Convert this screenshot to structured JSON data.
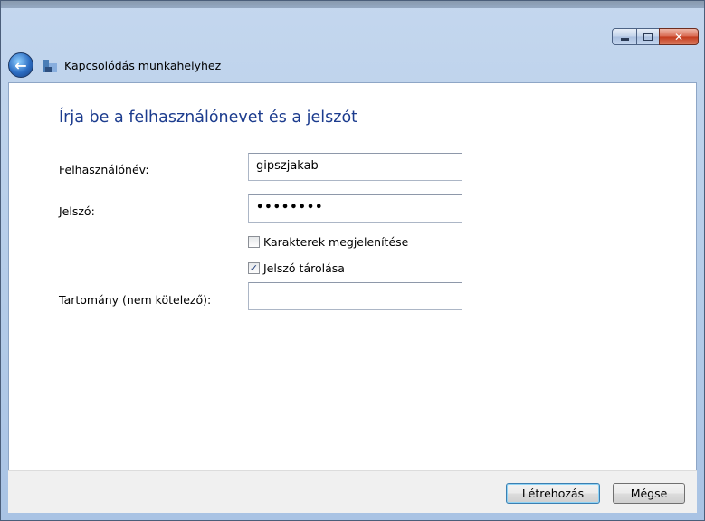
{
  "window": {
    "title": "Kapcsolódás munkahelyhez",
    "minimize_icon": "minimize-icon",
    "maximize_icon": "maximize-icon",
    "close_glyph": "✕"
  },
  "nav": {
    "back_glyph": "←",
    "app_icon": "network-workplace-icon"
  },
  "main": {
    "heading": "Írja be a felhasználónevet és a jelszót",
    "username": {
      "label": "Felhasználónév:",
      "value": "gipszjakab"
    },
    "password": {
      "label": "Jelszó:",
      "value": "••••••••"
    },
    "show_chars": {
      "label": "Karakterek megjelenítése",
      "checked": false
    },
    "save_password": {
      "label": "Jelszó tárolása",
      "checked": true,
      "check_glyph": "✓"
    },
    "domain": {
      "label": "Tartomány (nem kötelező):",
      "value": ""
    }
  },
  "footer": {
    "create_label": "Létrehozás",
    "cancel_label": "Mégse"
  }
}
